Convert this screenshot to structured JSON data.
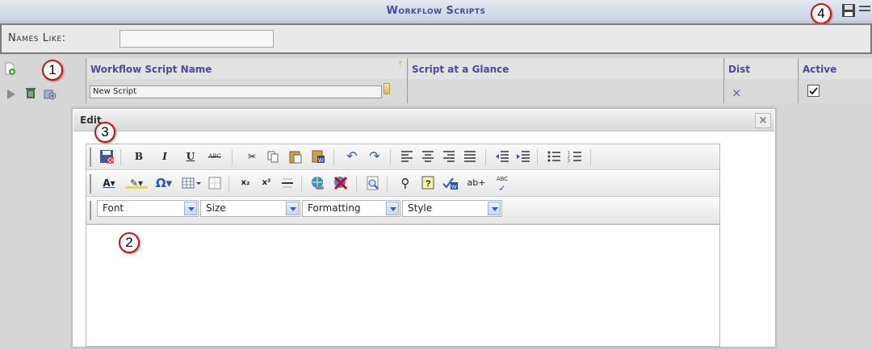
{
  "window": {
    "title": "Workflow Scripts"
  },
  "filter": {
    "label": "Names Like:",
    "value": ""
  },
  "grid": {
    "columns": [
      "Workflow Script Name",
      "Script at a Glance",
      "Dist",
      "Active"
    ],
    "row": {
      "name": "New Script",
      "dist": "×",
      "active": true
    }
  },
  "callouts": [
    "1",
    "2",
    "3",
    "4"
  ],
  "dialog": {
    "title": "Edit",
    "close": "×",
    "toolbar": {
      "bold": "B",
      "italic": "I",
      "underline": "U",
      "strike": "ABC",
      "subscript": "x₂",
      "superscript": "x²",
      "spellcheck": "ABC",
      "charmap": "Ω",
      "insert_field": "ab+"
    },
    "selects": [
      {
        "label": "Font"
      },
      {
        "label": "Size"
      },
      {
        "label": "Formatting"
      },
      {
        "label": "Style"
      }
    ]
  }
}
